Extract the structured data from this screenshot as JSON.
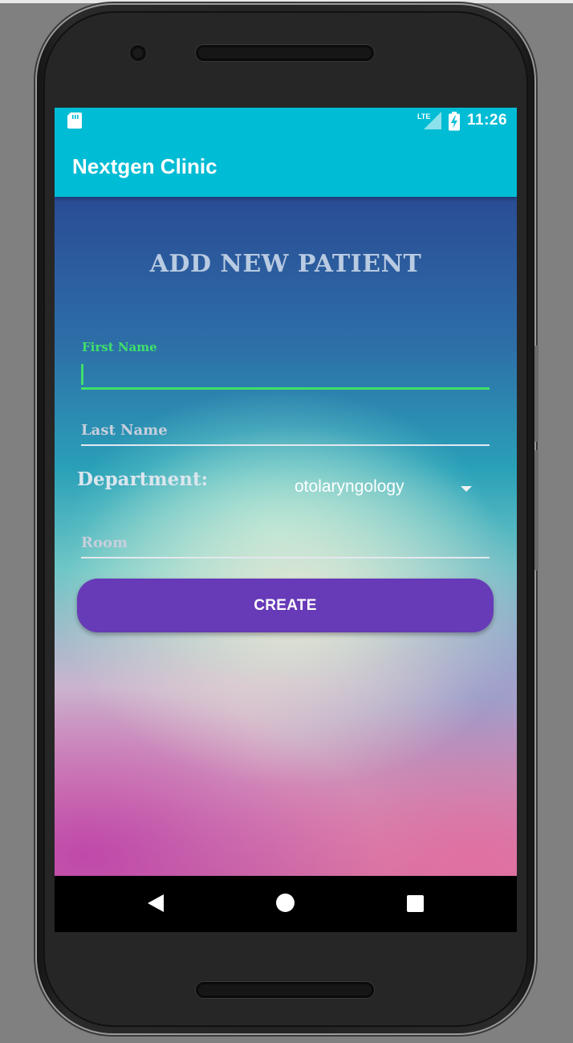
{
  "status_bar": {
    "time": "11:26",
    "network": "LTE",
    "icons": [
      "sd-card-icon",
      "lte-signal-icon",
      "battery-charging-icon"
    ]
  },
  "app_bar": {
    "title": "Nextgen Clinic",
    "color": "#00bcd4"
  },
  "form": {
    "title": "ADD NEW PATIENT",
    "first_name": {
      "label": "First Name",
      "value": "",
      "focused": true
    },
    "last_name": {
      "placeholder": "Last Name",
      "value": ""
    },
    "department": {
      "label": "Department:",
      "selected": "otolaryngology"
    },
    "room": {
      "placeholder": "Room",
      "value": ""
    },
    "create_button": "CREATE"
  },
  "nav_bar": {
    "icons": [
      "back-icon",
      "home-icon",
      "recent-apps-icon"
    ]
  },
  "colors": {
    "accent": "#3fe06a",
    "button": "#673ab7",
    "app_bar": "#00bcd4"
  }
}
